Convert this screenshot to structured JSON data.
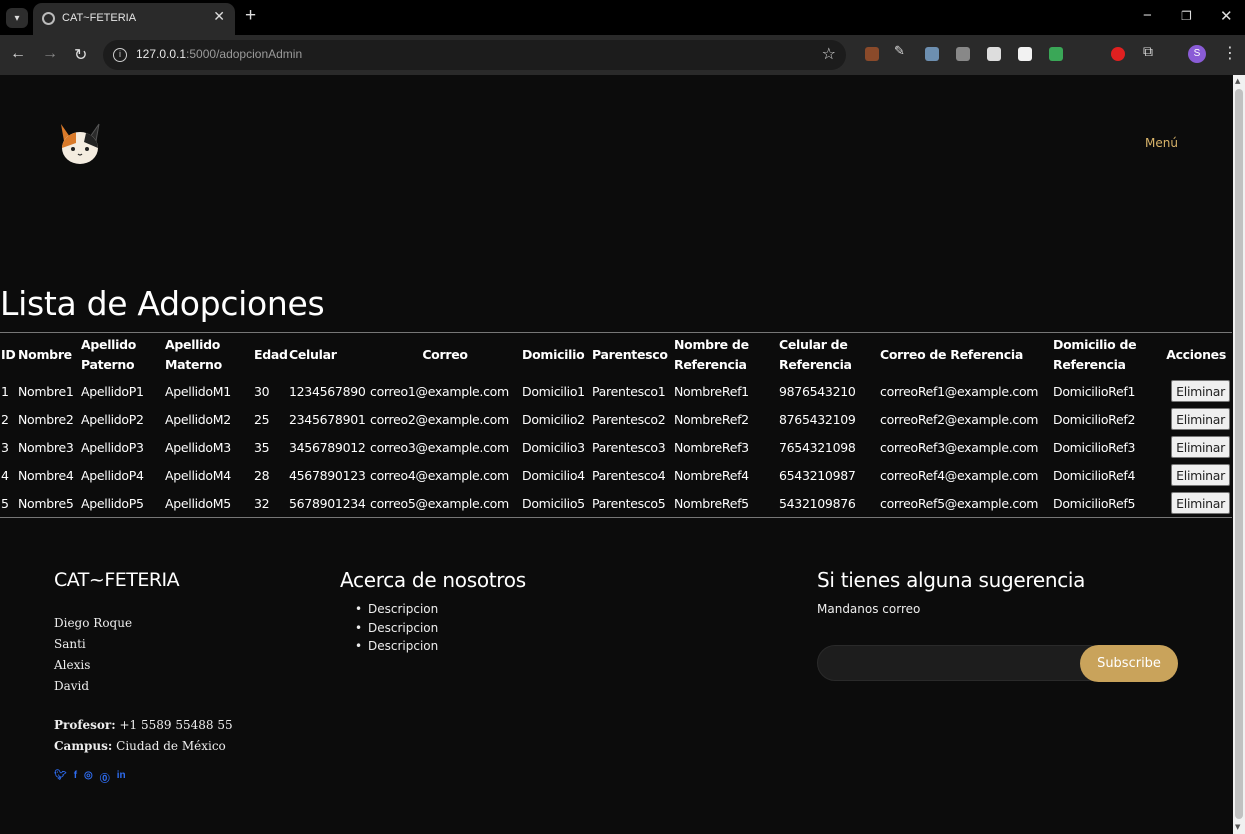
{
  "browser": {
    "tab_title": "CAT~FETERIA",
    "url_host": "127.0.0.1",
    "url_path": ":5000/adopcionAdmin",
    "profile_initial": "S"
  },
  "site": {
    "menu_label": "Menú"
  },
  "main": {
    "title": "Lista de Adopciones",
    "headers": [
      "ID",
      "Nombre",
      "Apellido Paterno",
      "Apellido Materno",
      "Edad",
      "Celular",
      "Correo",
      "Domicilio",
      "Parentesco",
      "Nombre de Referencia",
      "Celular de Referencia",
      "Correo de Referencia",
      "Domicilio de Referencia",
      "Acciones"
    ],
    "delete_label": "Eliminar",
    "rows": [
      [
        "1",
        "Nombre1",
        "ApellidoP1",
        "ApellidoM1",
        "30",
        "1234567890",
        "correo1@example.com",
        "Domicilio1",
        "Parentesco1",
        "NombreRef1",
        "9876543210",
        "correoRef1@example.com",
        "DomicilioRef1"
      ],
      [
        "2",
        "Nombre2",
        "ApellidoP2",
        "ApellidoM2",
        "25",
        "2345678901",
        "correo2@example.com",
        "Domicilio2",
        "Parentesco2",
        "NombreRef2",
        "8765432109",
        "correoRef2@example.com",
        "DomicilioRef2"
      ],
      [
        "3",
        "Nombre3",
        "ApellidoP3",
        "ApellidoM3",
        "35",
        "3456789012",
        "correo3@example.com",
        "Domicilio3",
        "Parentesco3",
        "NombreRef3",
        "7654321098",
        "correoRef3@example.com",
        "DomicilioRef3"
      ],
      [
        "4",
        "Nombre4",
        "ApellidoP4",
        "ApellidoM4",
        "28",
        "4567890123",
        "correo4@example.com",
        "Domicilio4",
        "Parentesco4",
        "NombreRef4",
        "6543210987",
        "correoRef4@example.com",
        "DomicilioRef4"
      ],
      [
        "5",
        "Nombre5",
        "ApellidoP5",
        "ApellidoM5",
        "32",
        "5678901234",
        "correo5@example.com",
        "Domicilio5",
        "Parentesco5",
        "NombreRef5",
        "5432109876",
        "correoRef5@example.com",
        "DomicilioRef5"
      ]
    ]
  },
  "footer": {
    "brand": "CAT~FETERIA",
    "names": [
      "Diego Roque",
      "Santi",
      "Alexis",
      "David"
    ],
    "profesor_label": "Profesor:",
    "profesor_value": "+1 5589 55488 55",
    "campus_label": "Campus:",
    "campus_value": "Ciudad de México",
    "social_icons": [
      "twitter-icon",
      "facebook-icon",
      "instagram-icon",
      "skype-icon",
      "linkedin-icon"
    ],
    "about_title": "Acerca de nosotros",
    "about_items": [
      "Descripcion",
      "Descripcion",
      "Descripcion"
    ],
    "suggest_title": "Si tienes alguna sugerencia",
    "suggest_text": "Mandanos correo",
    "subscribe_label": "Subscribe"
  },
  "colors": {
    "accent": "#c9a35b",
    "menu": "#d9b46a",
    "background": "#0c0c0c",
    "social": "#2e6cf0"
  }
}
